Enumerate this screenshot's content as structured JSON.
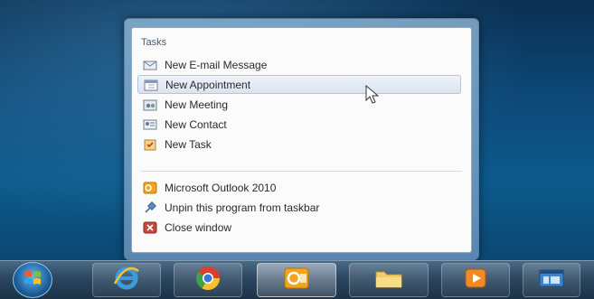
{
  "jumplist": {
    "tasks_heading": "Tasks",
    "tasks": [
      {
        "label": "New E-mail Message",
        "icon": "envelope-icon"
      },
      {
        "label": "New Appointment",
        "icon": "calendar-icon"
      },
      {
        "label": "New Meeting",
        "icon": "meeting-icon"
      },
      {
        "label": "New Contact",
        "icon": "contact-card-icon"
      },
      {
        "label": "New Task",
        "icon": "task-clipboard-icon"
      }
    ],
    "app_actions": [
      {
        "label": "Microsoft Outlook 2010",
        "icon": "outlook-icon"
      },
      {
        "label": "Unpin this program from taskbar",
        "icon": "pin-icon"
      },
      {
        "label": "Close window",
        "icon": "close-window-icon"
      }
    ]
  },
  "taskbar": {
    "items": [
      {
        "name": "start-button",
        "icon": "windows-logo-icon"
      },
      {
        "name": "internet-explorer",
        "icon": "internet-explorer-icon"
      },
      {
        "name": "chrome",
        "icon": "chrome-icon"
      },
      {
        "name": "outlook",
        "icon": "outlook-icon"
      },
      {
        "name": "windows-explorer",
        "icon": "folder-icon"
      },
      {
        "name": "media-player",
        "icon": "media-player-icon"
      },
      {
        "name": "ie-frame",
        "icon": "window-app-icon"
      }
    ]
  },
  "colors": {
    "hover_bg": "#dbe4ee",
    "outlook_orange": "#f2a41a",
    "desktop_blue": "#0c5a8c"
  }
}
